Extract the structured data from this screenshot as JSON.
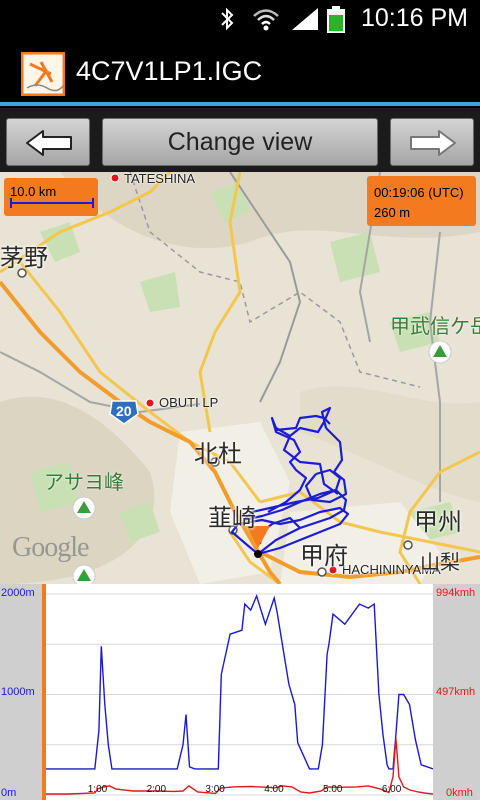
{
  "status_bar": {
    "time": "10:16 PM",
    "icons": [
      "bluetooth-icon",
      "wifi-icon",
      "signal-icon",
      "battery-icon"
    ]
  },
  "app": {
    "title": "4C7V1LP1.IGC",
    "accent_color": "#3aa6df"
  },
  "toolbar": {
    "back_icon": "left-arrow-icon",
    "change_view_label": "Change view",
    "forward_icon": "right-arrow-icon"
  },
  "map": {
    "scale_label": "10.0 km",
    "overlay_time": "00:19:06 (UTC)",
    "overlay_altitude": "260 m",
    "waypoints": {
      "tateshina": "TATESHINA",
      "obuti": "OBUTI LP",
      "hachininyama": "HACHININYAMA"
    },
    "places": {
      "chino": "茅野",
      "hokuto": "北杜",
      "nirasaki": "韮崎",
      "kofu": "甲府",
      "koshu": "甲州",
      "kobushigatake": "甲武信ケ岳",
      "asayomine": "アサヨ峰",
      "yamanashi_partial": "山梨"
    },
    "route_number": "20",
    "attribution": "Google",
    "colors": {
      "track": "#1c1cd6",
      "waypoint": "#e0161b",
      "overlay": "#f47a20"
    }
  },
  "chart_data": {
    "type": "line",
    "y_left": {
      "ticks": [
        "2000m",
        "1000m",
        "0m"
      ],
      "range": [
        0,
        2000
      ],
      "unit": "m",
      "color": "#1a1ad0"
    },
    "y_right": {
      "ticks": [
        "994kmh",
        "497kmh",
        "0kmh"
      ],
      "range": [
        0,
        994
      ],
      "unit": "kmh",
      "color": "#e11919"
    },
    "x_ticks": [
      "1:00",
      "2:00",
      "3:00",
      "4:00",
      "5:00",
      "6:00"
    ],
    "x_range_hours": [
      0.12,
      6.7
    ],
    "series": [
      {
        "key": "altitude",
        "x": [
          0.12,
          0.5,
          0.95,
          1.02,
          1.06,
          1.12,
          1.18,
          1.24,
          1.5,
          2.0,
          2.35,
          2.45,
          2.5,
          2.56,
          2.65,
          2.8,
          3.05,
          3.1,
          3.25,
          3.45,
          3.5,
          3.6,
          3.7,
          3.85,
          4.0,
          4.05,
          4.25,
          4.35,
          4.4,
          4.6,
          4.75,
          4.82,
          4.9,
          4.93,
          5.0,
          5.2,
          5.45,
          5.6,
          5.7,
          5.78,
          5.85,
          5.92,
          5.95,
          6.02,
          6.07,
          6.12,
          6.2,
          6.3,
          6.4,
          6.5,
          6.7
        ],
        "y": [
          260,
          260,
          260,
          640,
          1480,
          900,
          500,
          260,
          260,
          260,
          260,
          500,
          800,
          280,
          260,
          260,
          260,
          1200,
          1600,
          1640,
          1900,
          1840,
          1980,
          1700,
          1960,
          1820,
          1100,
          900,
          520,
          260,
          260,
          500,
          1400,
          1500,
          1800,
          1700,
          1900,
          1860,
          1900,
          1000,
          600,
          300,
          260,
          260,
          600,
          1000,
          1000,
          900,
          550,
          300,
          260
        ]
      },
      {
        "key": "speed",
        "x": [
          0.12,
          0.5,
          0.95,
          1.0,
          1.1,
          1.2,
          1.3,
          1.6,
          2.0,
          2.3,
          2.45,
          2.55,
          2.7,
          3.0,
          3.1,
          3.3,
          3.6,
          3.9,
          4.0,
          4.15,
          4.3,
          4.45,
          4.6,
          4.8,
          4.9,
          5.1,
          5.4,
          5.6,
          5.8,
          5.95,
          6.02,
          6.07,
          6.12,
          6.2,
          6.3,
          6.45,
          6.55,
          6.7
        ],
        "y": [
          5,
          5,
          10,
          30,
          40,
          45,
          30,
          20,
          20,
          18,
          20,
          45,
          15,
          8,
          35,
          40,
          42,
          38,
          35,
          45,
          40,
          15,
          10,
          20,
          40,
          38,
          40,
          45,
          30,
          12,
          90,
          280,
          90,
          40,
          25,
          15,
          10,
          5
        ]
      }
    ]
  }
}
